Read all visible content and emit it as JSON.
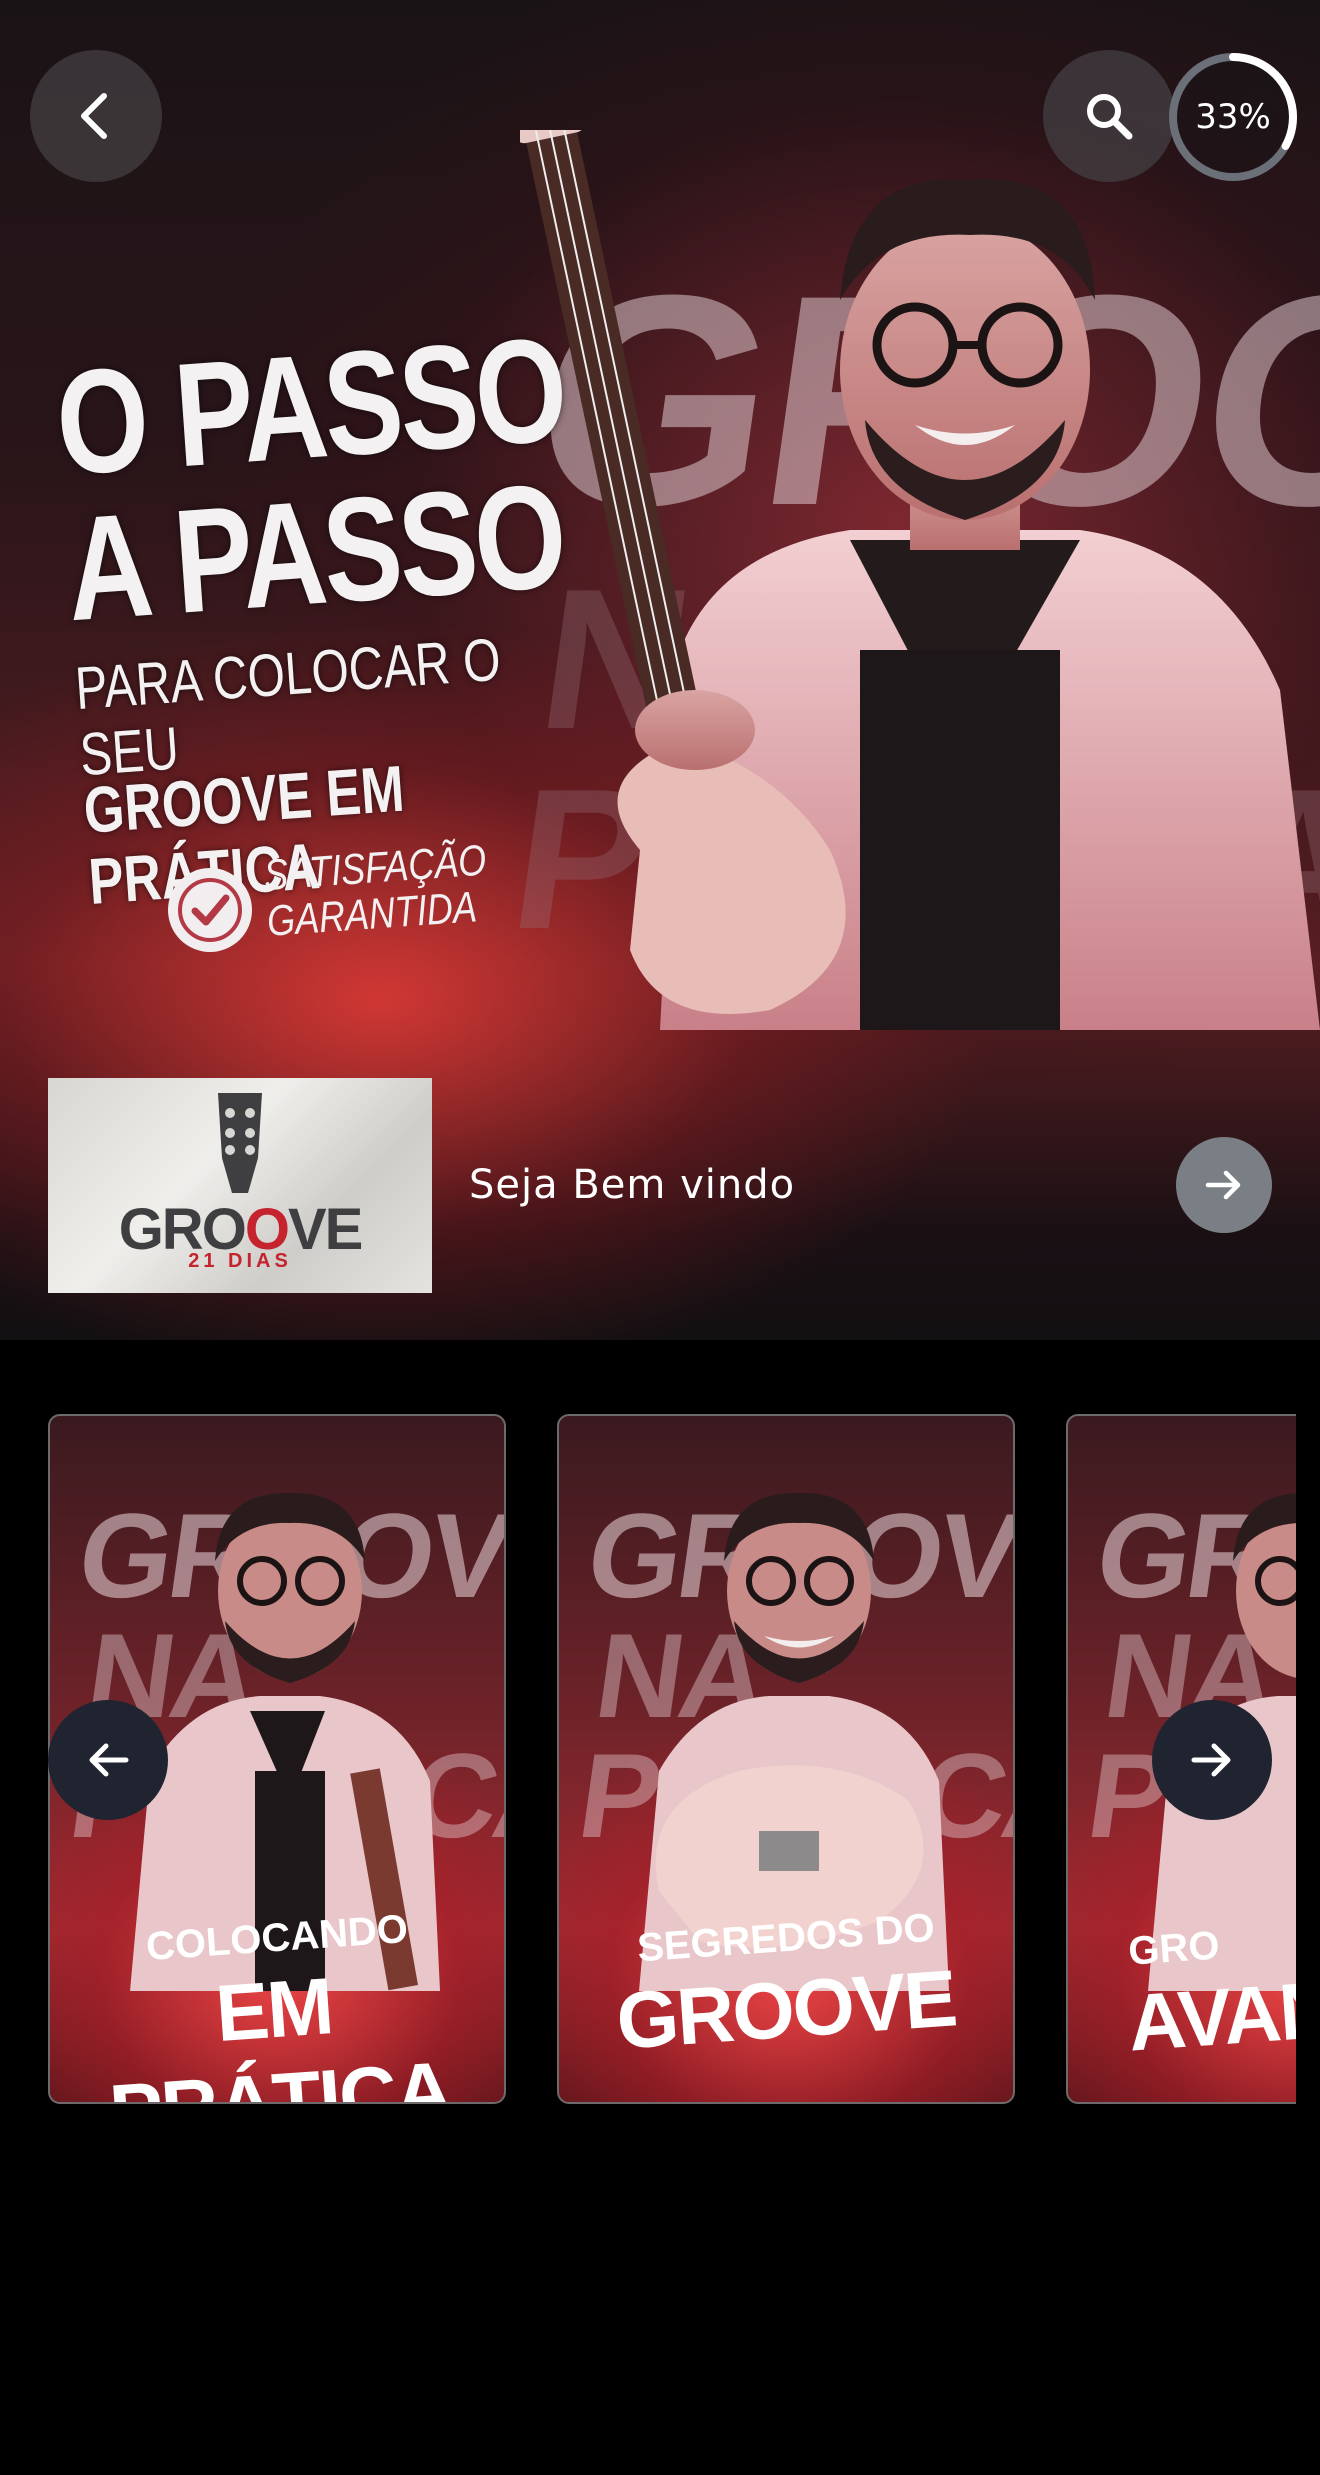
{
  "header": {
    "back_icon": "chevron-left-icon",
    "search_icon": "search-icon",
    "progress_text": "33%",
    "progress_fraction": 0.33
  },
  "hero": {
    "bg_word_1": "GROOVE",
    "bg_word_2": "NA PRÁTICA",
    "headline_line1": "O PASSO",
    "headline_line2": "A PASSO",
    "headline_line3": "PARA COLOCAR O SEU",
    "headline_line4": "GROOVE EM PRÁTICA",
    "badge_line1": "SATISFAÇÃO",
    "badge_line2": "GARANTIDA"
  },
  "module": {
    "thumb_title_a": "GRO",
    "thumb_title_o": "O",
    "thumb_title_b": "VE",
    "thumb_subtitle": "21 DIAS",
    "title": "Seja Bem vindo"
  },
  "carousel": {
    "cards": [
      {
        "bg_1": "GROOVE",
        "bg_2": "NA PRÁTICA",
        "line1": "COLOCANDO",
        "line2": "EM PRÁTICA"
      },
      {
        "bg_1": "GROOVE",
        "bg_2": "NA PRÁTICA",
        "line1": "SEGREDOS DO",
        "line2": "GROOVE"
      },
      {
        "bg_1": "GROOVE",
        "bg_2": "NA PRÁTICA",
        "line1": "GRO",
        "line2": "AVAN"
      }
    ]
  },
  "colors": {
    "accent_red": "#c5232d",
    "nav_button": "#1f2430",
    "hero_next_button": "#7a7f86"
  }
}
